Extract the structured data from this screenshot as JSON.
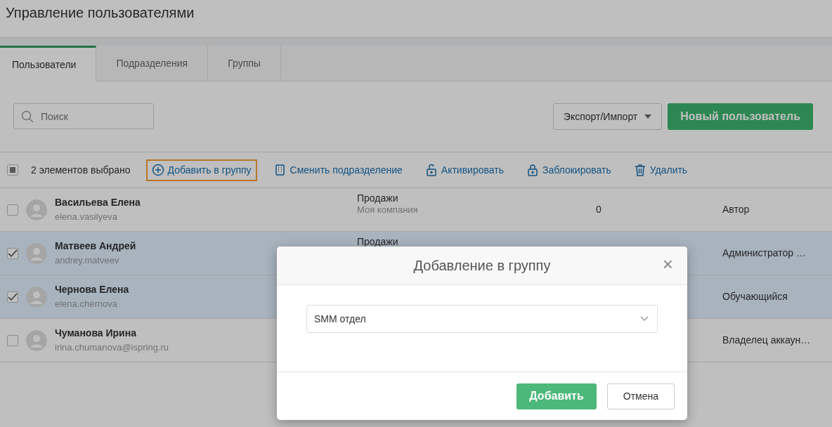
{
  "page": {
    "title": "Управление пользователями"
  },
  "tabs": [
    {
      "label": "Пользователи",
      "selected": true
    },
    {
      "label": "Подразделения",
      "selected": false
    },
    {
      "label": "Группы",
      "selected": false
    }
  ],
  "search": {
    "placeholder": "Поиск"
  },
  "export_button": {
    "label": "Экспорт/Импорт"
  },
  "new_user_button": {
    "label": "Новый пользователь"
  },
  "bulk_bar": {
    "indeterminate": true,
    "selection_text": "2 элементов выбрано",
    "actions": [
      {
        "kind": "add",
        "label": "Добавить в группу",
        "highlighted": true
      },
      {
        "kind": "move",
        "label": "Сменить подразделение",
        "highlighted": false
      },
      {
        "kind": "unlock",
        "label": "Активировать",
        "highlighted": false
      },
      {
        "kind": "lock",
        "label": "Заблокировать",
        "highlighted": false
      },
      {
        "kind": "delete",
        "label": "Удалить",
        "highlighted": false
      }
    ]
  },
  "users": [
    {
      "name": "Васильева Елена",
      "login": "elena.vasilyeva",
      "department": "Продажи",
      "organization": "Моя компания",
      "count": "0",
      "role": "Автор",
      "selected": false
    },
    {
      "name": "Матвеев Андрей",
      "login": "andrey.matveev",
      "department": "Продажи",
      "role": "Администратор …",
      "selected": true
    },
    {
      "name": "Чернова Елена",
      "login": "elena.chernova",
      "role": "Обучающийся",
      "selected": true
    },
    {
      "name": "Чуманова Ирина",
      "login": "irina.chumanova@ispring.ru",
      "role": "Владелец аккаун…",
      "selected": false
    }
  ],
  "dialog": {
    "title": "Добавление в группу",
    "close": "×",
    "group_select": {
      "value": "SMM отдел"
    },
    "buttons": [
      {
        "kind": "primary",
        "label": "Добавить"
      },
      {
        "kind": "secondary",
        "label": "Отмена"
      }
    ]
  }
}
